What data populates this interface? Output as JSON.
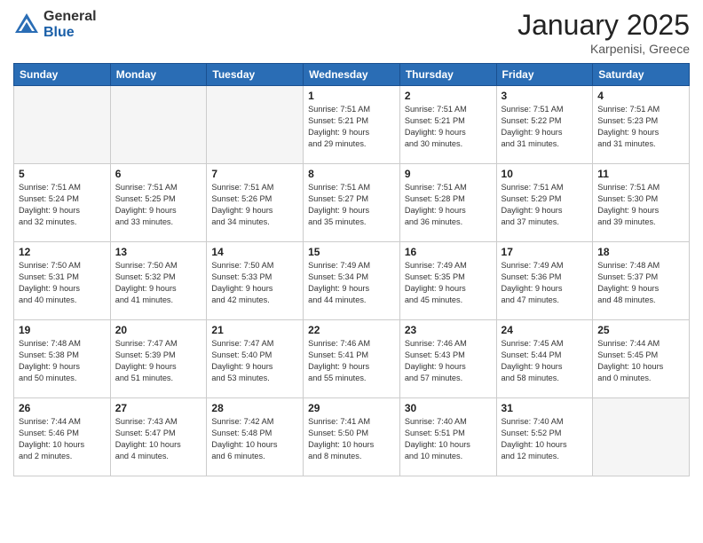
{
  "logo": {
    "general": "General",
    "blue": "Blue"
  },
  "header": {
    "month": "January 2025",
    "location": "Karpenisi, Greece"
  },
  "weekdays": [
    "Sunday",
    "Monday",
    "Tuesday",
    "Wednesday",
    "Thursday",
    "Friday",
    "Saturday"
  ],
  "weeks": [
    [
      {
        "day": "",
        "info": ""
      },
      {
        "day": "",
        "info": ""
      },
      {
        "day": "",
        "info": ""
      },
      {
        "day": "1",
        "info": "Sunrise: 7:51 AM\nSunset: 5:21 PM\nDaylight: 9 hours\nand 29 minutes."
      },
      {
        "day": "2",
        "info": "Sunrise: 7:51 AM\nSunset: 5:21 PM\nDaylight: 9 hours\nand 30 minutes."
      },
      {
        "day": "3",
        "info": "Sunrise: 7:51 AM\nSunset: 5:22 PM\nDaylight: 9 hours\nand 31 minutes."
      },
      {
        "day": "4",
        "info": "Sunrise: 7:51 AM\nSunset: 5:23 PM\nDaylight: 9 hours\nand 31 minutes."
      }
    ],
    [
      {
        "day": "5",
        "info": "Sunrise: 7:51 AM\nSunset: 5:24 PM\nDaylight: 9 hours\nand 32 minutes."
      },
      {
        "day": "6",
        "info": "Sunrise: 7:51 AM\nSunset: 5:25 PM\nDaylight: 9 hours\nand 33 minutes."
      },
      {
        "day": "7",
        "info": "Sunrise: 7:51 AM\nSunset: 5:26 PM\nDaylight: 9 hours\nand 34 minutes."
      },
      {
        "day": "8",
        "info": "Sunrise: 7:51 AM\nSunset: 5:27 PM\nDaylight: 9 hours\nand 35 minutes."
      },
      {
        "day": "9",
        "info": "Sunrise: 7:51 AM\nSunset: 5:28 PM\nDaylight: 9 hours\nand 36 minutes."
      },
      {
        "day": "10",
        "info": "Sunrise: 7:51 AM\nSunset: 5:29 PM\nDaylight: 9 hours\nand 37 minutes."
      },
      {
        "day": "11",
        "info": "Sunrise: 7:51 AM\nSunset: 5:30 PM\nDaylight: 9 hours\nand 39 minutes."
      }
    ],
    [
      {
        "day": "12",
        "info": "Sunrise: 7:50 AM\nSunset: 5:31 PM\nDaylight: 9 hours\nand 40 minutes."
      },
      {
        "day": "13",
        "info": "Sunrise: 7:50 AM\nSunset: 5:32 PM\nDaylight: 9 hours\nand 41 minutes."
      },
      {
        "day": "14",
        "info": "Sunrise: 7:50 AM\nSunset: 5:33 PM\nDaylight: 9 hours\nand 42 minutes."
      },
      {
        "day": "15",
        "info": "Sunrise: 7:49 AM\nSunset: 5:34 PM\nDaylight: 9 hours\nand 44 minutes."
      },
      {
        "day": "16",
        "info": "Sunrise: 7:49 AM\nSunset: 5:35 PM\nDaylight: 9 hours\nand 45 minutes."
      },
      {
        "day": "17",
        "info": "Sunrise: 7:49 AM\nSunset: 5:36 PM\nDaylight: 9 hours\nand 47 minutes."
      },
      {
        "day": "18",
        "info": "Sunrise: 7:48 AM\nSunset: 5:37 PM\nDaylight: 9 hours\nand 48 minutes."
      }
    ],
    [
      {
        "day": "19",
        "info": "Sunrise: 7:48 AM\nSunset: 5:38 PM\nDaylight: 9 hours\nand 50 minutes."
      },
      {
        "day": "20",
        "info": "Sunrise: 7:47 AM\nSunset: 5:39 PM\nDaylight: 9 hours\nand 51 minutes."
      },
      {
        "day": "21",
        "info": "Sunrise: 7:47 AM\nSunset: 5:40 PM\nDaylight: 9 hours\nand 53 minutes."
      },
      {
        "day": "22",
        "info": "Sunrise: 7:46 AM\nSunset: 5:41 PM\nDaylight: 9 hours\nand 55 minutes."
      },
      {
        "day": "23",
        "info": "Sunrise: 7:46 AM\nSunset: 5:43 PM\nDaylight: 9 hours\nand 57 minutes."
      },
      {
        "day": "24",
        "info": "Sunrise: 7:45 AM\nSunset: 5:44 PM\nDaylight: 9 hours\nand 58 minutes."
      },
      {
        "day": "25",
        "info": "Sunrise: 7:44 AM\nSunset: 5:45 PM\nDaylight: 10 hours\nand 0 minutes."
      }
    ],
    [
      {
        "day": "26",
        "info": "Sunrise: 7:44 AM\nSunset: 5:46 PM\nDaylight: 10 hours\nand 2 minutes."
      },
      {
        "day": "27",
        "info": "Sunrise: 7:43 AM\nSunset: 5:47 PM\nDaylight: 10 hours\nand 4 minutes."
      },
      {
        "day": "28",
        "info": "Sunrise: 7:42 AM\nSunset: 5:48 PM\nDaylight: 10 hours\nand 6 minutes."
      },
      {
        "day": "29",
        "info": "Sunrise: 7:41 AM\nSunset: 5:50 PM\nDaylight: 10 hours\nand 8 minutes."
      },
      {
        "day": "30",
        "info": "Sunrise: 7:40 AM\nSunset: 5:51 PM\nDaylight: 10 hours\nand 10 minutes."
      },
      {
        "day": "31",
        "info": "Sunrise: 7:40 AM\nSunset: 5:52 PM\nDaylight: 10 hours\nand 12 minutes."
      },
      {
        "day": "",
        "info": ""
      }
    ]
  ]
}
